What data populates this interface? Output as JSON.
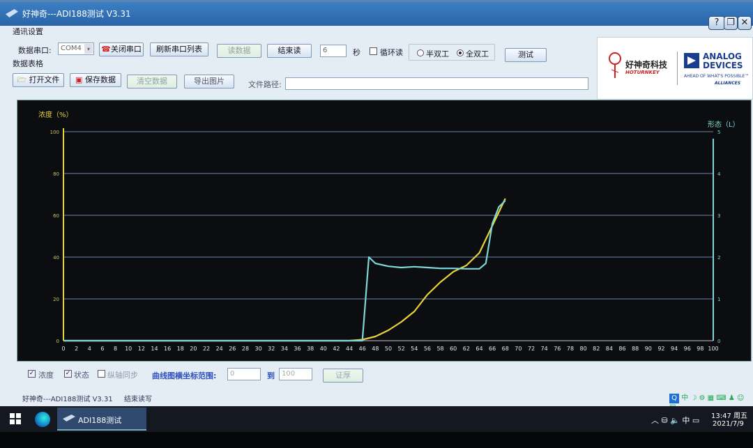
{
  "window": {
    "title": "好神奇---ADI188测试 V3.31"
  },
  "comm": {
    "group_label": "通讯设置",
    "port_label": "数据串口:",
    "port_value": "COM4",
    "close_port": "关闭串口",
    "refresh_ports": "刷新串口列表",
    "read_data": "读数据",
    "end_read": "结束读",
    "interval_value": "6",
    "seconds_label": "秒",
    "loop_read": "循环读",
    "half_duplex": "半双工",
    "full_duplex": "全双工",
    "duplex_selected": "全双工",
    "test": "测试"
  },
  "data": {
    "group_label": "数据表格",
    "open_file": "打开文件",
    "save_data": "保存数据",
    "clear_data": "清空数据",
    "export_image": "导出图片",
    "file_path_label": "文件路径:",
    "file_path_value": ""
  },
  "logo": {
    "brand_cn": "好神奇科技",
    "brand_en": "HOTURNKEY",
    "adi_line1": "ANALOG",
    "adi_line2": "DEVICES",
    "adi_tag": "AHEAD OF WHAT'S POSSIBLE™",
    "adi_sub": "ALLIANCES"
  },
  "chart_data": {
    "type": "line",
    "ylabel_left": "浓度（%）",
    "ylabel_right": "形态（L）",
    "xlim": [
      0,
      100
    ],
    "ylim_left": [
      0,
      100
    ],
    "ylim_right": [
      0,
      5
    ],
    "x_ticks": [
      0,
      2,
      4,
      6,
      8,
      10,
      12,
      14,
      16,
      18,
      20,
      22,
      24,
      26,
      28,
      30,
      32,
      34,
      36,
      38,
      40,
      42,
      44,
      46,
      48,
      50,
      52,
      54,
      56,
      58,
      60,
      62,
      64,
      66,
      68,
      70,
      72,
      74,
      76,
      78,
      80,
      82,
      84,
      86,
      88,
      90,
      92,
      94,
      96,
      98,
      100
    ],
    "y_ticks_left": [
      0,
      20,
      40,
      60,
      80,
      100
    ],
    "y_ticks_right": [
      0,
      1,
      2,
      3,
      4,
      5
    ],
    "grid": true,
    "colors": {
      "concentration": "#e8d43a",
      "state": "#7fd8d8",
      "grid": "#6f86a8",
      "axis_left": "#e8d43a",
      "axis_right": "#7fd8d8"
    },
    "series": [
      {
        "name": "浓度",
        "axis": "left",
        "x": [
          0,
          44,
          46,
          48,
          50,
          52,
          54,
          56,
          58,
          60,
          62,
          64,
          66,
          68
        ],
        "y": [
          0,
          0,
          0.5,
          2,
          5,
          9,
          14,
          22,
          28,
          33,
          36,
          42,
          55,
          68
        ]
      },
      {
        "name": "状态",
        "axis": "right",
        "x": [
          0,
          46,
          47,
          48,
          50,
          52,
          54,
          56,
          58,
          60,
          62,
          64,
          65,
          66,
          67,
          68
        ],
        "y": [
          0,
          0,
          2,
          1.85,
          1.78,
          1.75,
          1.77,
          1.75,
          1.73,
          1.73,
          1.72,
          1.72,
          1.85,
          2.8,
          3.2,
          3.35
        ]
      }
    ]
  },
  "bottom": {
    "conc_label": "浓度",
    "state_label": "状态",
    "vertical_sync": "纵轴同步",
    "range_label": "曲线图横坐标范围:",
    "range_from": "0",
    "to_label": "到",
    "range_to": "100",
    "confirm": "证厚"
  },
  "status": {
    "app": "好神奇---ADI188测试 V3.31",
    "msg": "结束读写"
  },
  "taskbar": {
    "app_label": "ADI188测试",
    "time": "13:47 周五",
    "date": "2021/7/9",
    "ime": "中"
  }
}
